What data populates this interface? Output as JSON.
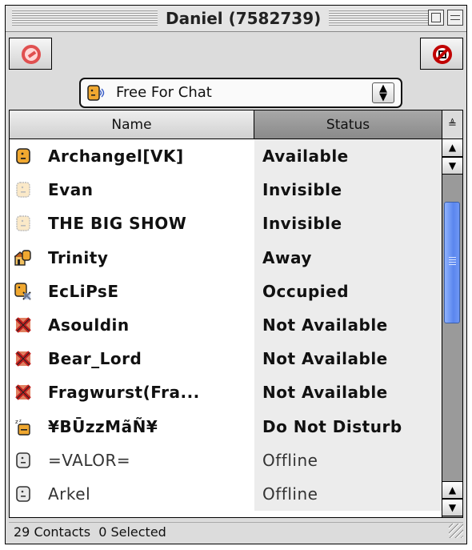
{
  "window": {
    "title": "Daniel (7582739)"
  },
  "toolbar": {
    "left_icon": "no-sign-icon",
    "right_icon": "no-sign-icon"
  },
  "presence": {
    "selected": "Free For Chat",
    "icon": "face-speaking-icon"
  },
  "columns": {
    "name": "Name",
    "status": "Status"
  },
  "contacts": [
    {
      "name": "Archangel[VK]",
      "status": "Available",
      "icon": "face-icon"
    },
    {
      "name": "Evan",
      "status": "Invisible",
      "icon": "faded-face-icon"
    },
    {
      "name": "THE BIG SHOW",
      "status": "Invisible",
      "icon": "faded-face-icon"
    },
    {
      "name": "Trinity",
      "status": "Away",
      "icon": "away-house-icon"
    },
    {
      "name": "EcLiPsE",
      "status": "Occupied",
      "icon": "occupied-icon"
    },
    {
      "name": "Asouldin",
      "status": "Not Available",
      "icon": "na-x-icon"
    },
    {
      "name": "Bear_Lord",
      "status": "Not Available",
      "icon": "na-x-icon"
    },
    {
      "name": "Fragwurst(Fra...",
      "status": "Not Available",
      "icon": "na-x-icon"
    },
    {
      "name": "¥BŪzzMãÑ¥",
      "status": "Do Not Disturb",
      "icon": "dnd-sleep-icon"
    },
    {
      "name": "=VALOR=",
      "status": "Offline",
      "icon": "offline-face-icon"
    },
    {
      "name": "Arkel",
      "status": "Offline",
      "icon": "offline-face-icon"
    }
  ],
  "statusbar": {
    "text": "29 Contacts  0 Selected"
  },
  "colors": {
    "scroll_thumb": "#5a86ee",
    "na_red": "#c41e1e",
    "face_orange": "#f0a830"
  }
}
